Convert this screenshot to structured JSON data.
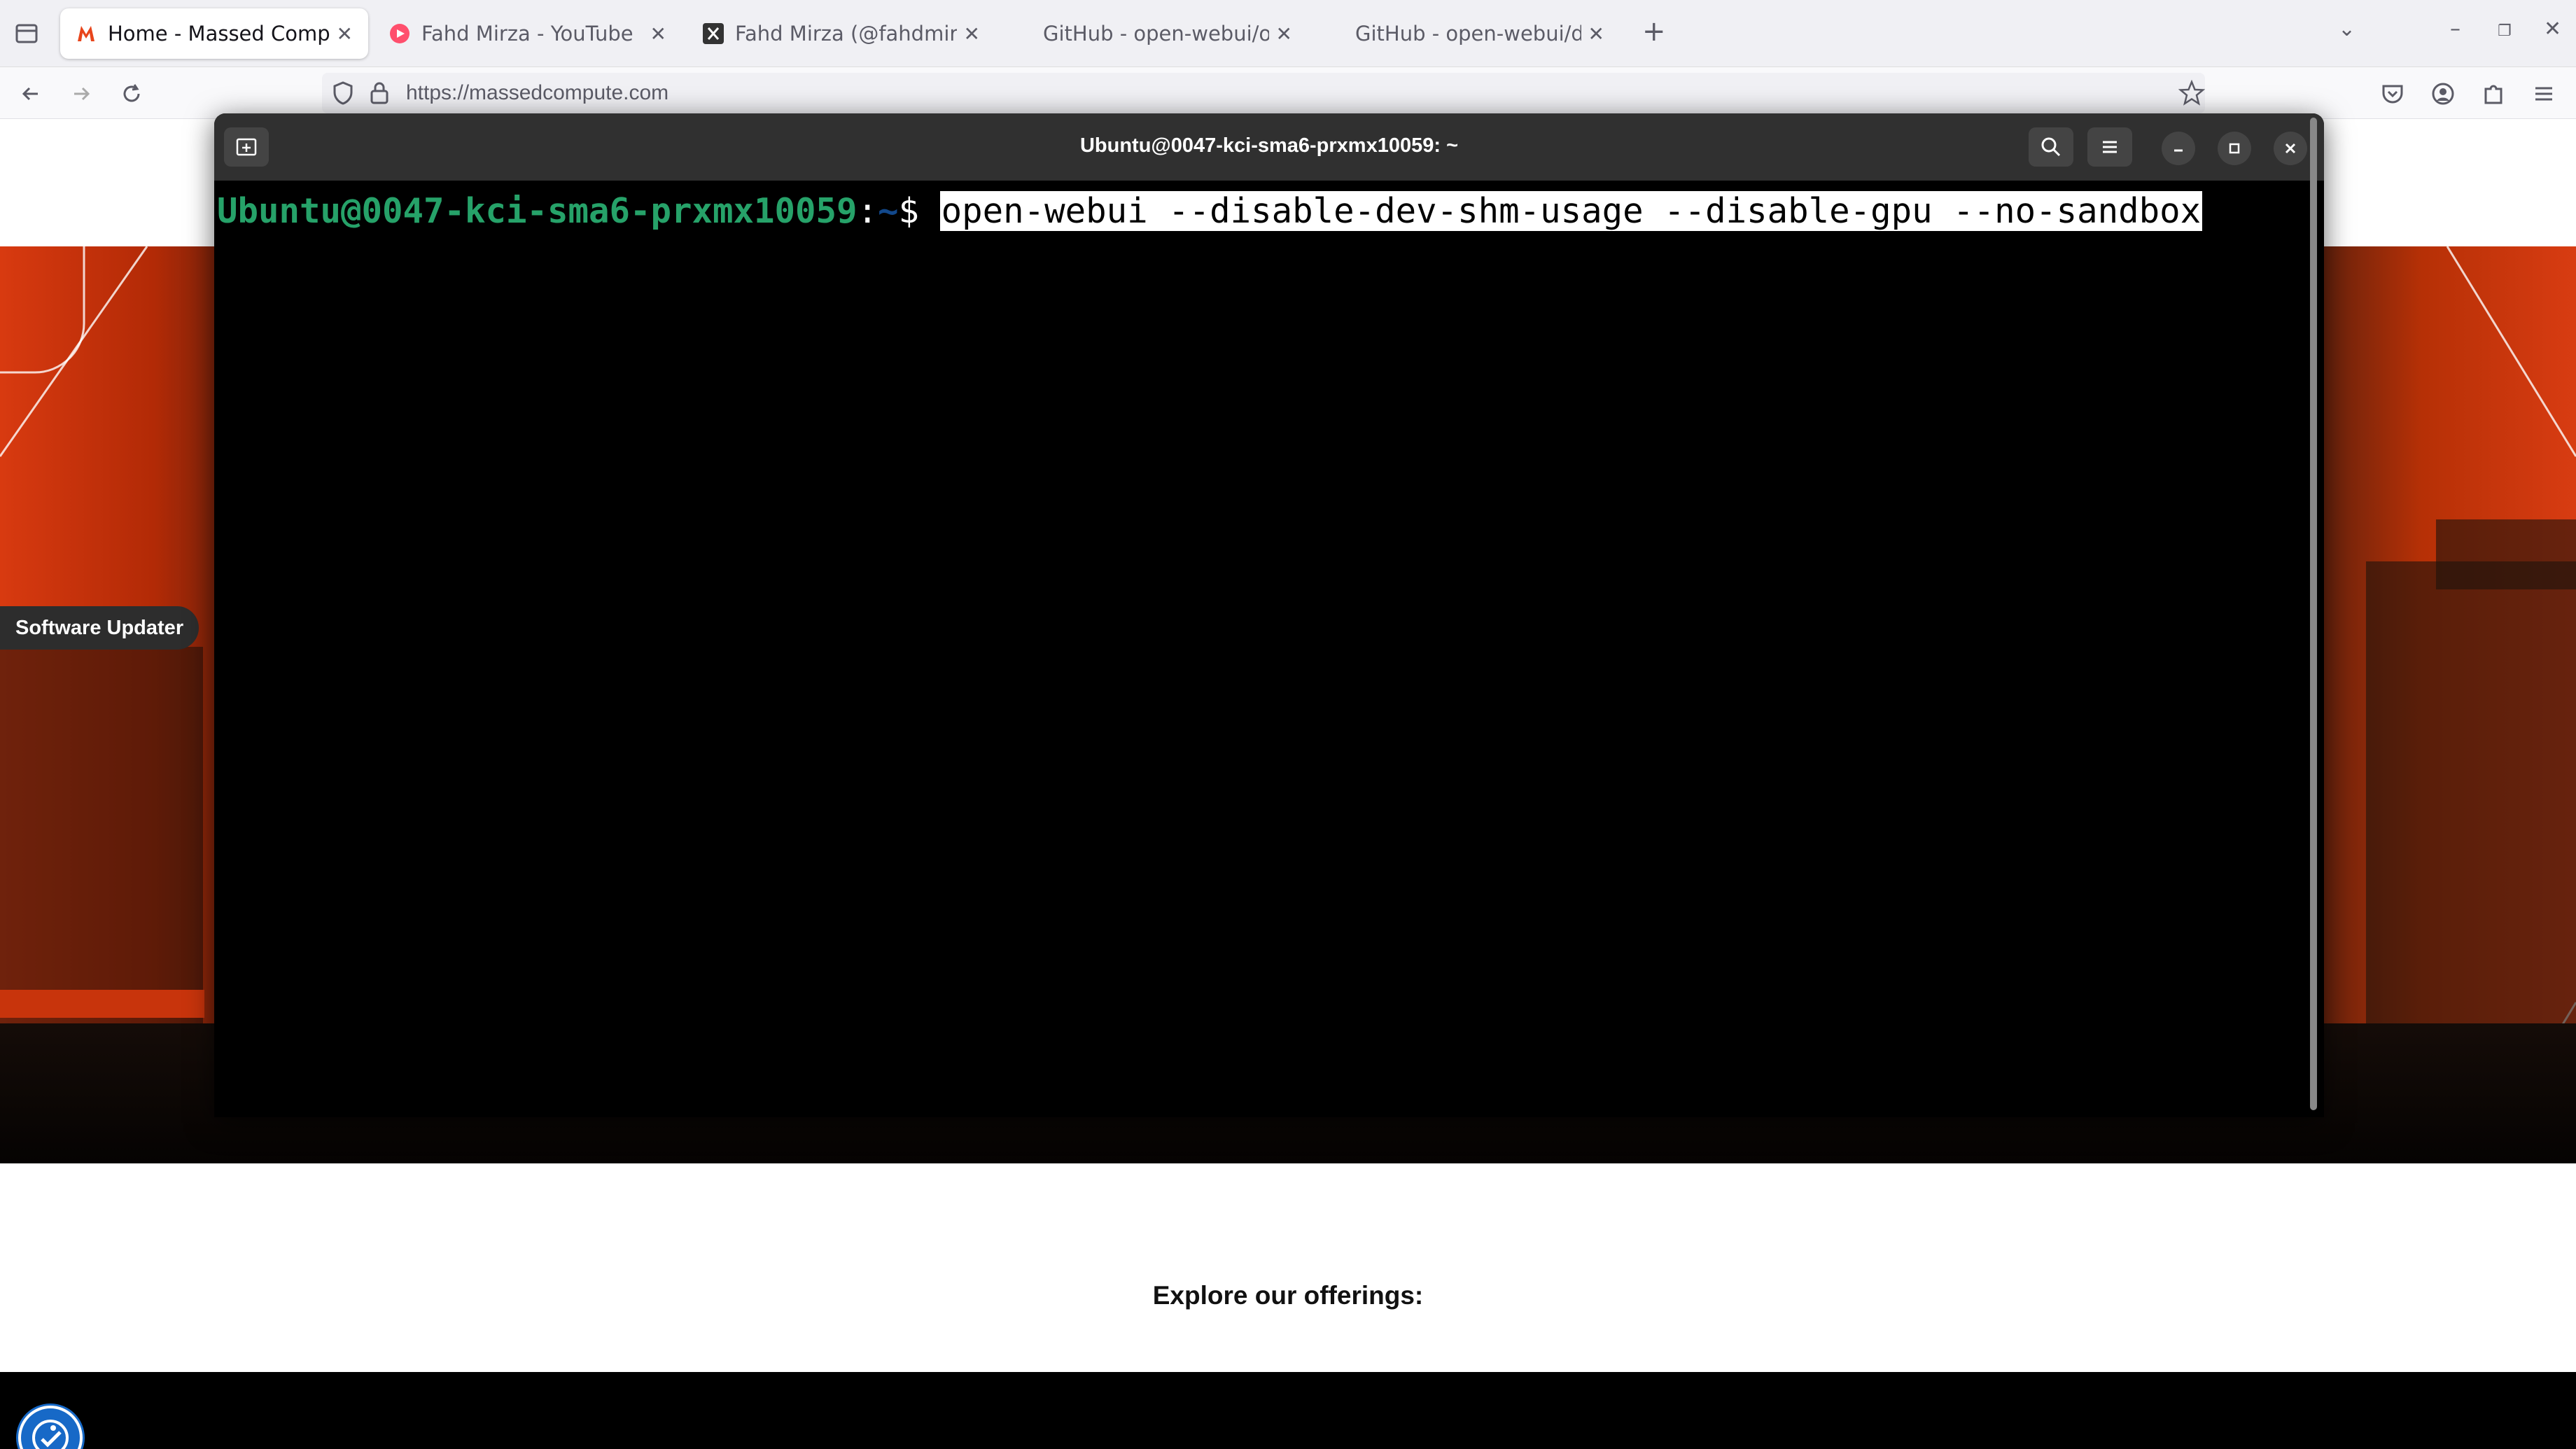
{
  "browser": {
    "tabs": [
      {
        "title": "Home - Massed Compute",
        "icon": "massed-compute-favicon",
        "active": true
      },
      {
        "title": "Fahd Mirza - YouTube",
        "icon": "youtube-favicon",
        "active": false
      },
      {
        "title": "Fahd Mirza (@fahdmirza",
        "icon": "x-favicon",
        "active": false
      },
      {
        "title": "GitHub - open-webui/op",
        "icon": "github-favicon",
        "active": false
      },
      {
        "title": "GitHub - open-webui/de",
        "icon": "github-favicon",
        "active": false
      }
    ],
    "new_tab_label": "+",
    "url": "https://massedcompute.com"
  },
  "page": {
    "offerings_heading": "Explore our offerings:"
  },
  "desktop": {
    "software_updater_label": "Software Updater"
  },
  "terminal": {
    "window_title": "Ubuntu@0047-kci-sma6-prxmx10059: ~",
    "prompt_userhost": "Ubuntu@0047-kci-sma6-prxmx10059",
    "prompt_colon": ":",
    "prompt_path": "~",
    "prompt_sign": "$ ",
    "command": "open-webui --disable-dev-shm-usage --disable-gpu --no-sandbox"
  },
  "colors": {
    "prompt_green": "#26a269",
    "prompt_blue": "#12488b",
    "brand_orange": "#d83a10",
    "accessibility_blue": "#1769c7"
  }
}
